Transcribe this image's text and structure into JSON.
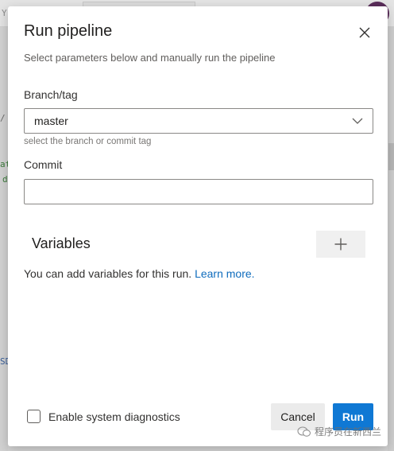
{
  "background": {
    "top_left_glyph": "Y",
    "left_glyphs": [
      "/",
      "at",
      "d",
      "SD"
    ]
  },
  "dialog": {
    "title": "Run pipeline",
    "subtitle": "Select parameters below and manually run the pipeline",
    "close_icon": "close-icon"
  },
  "branch": {
    "label": "Branch/tag",
    "value": "master",
    "helper": "select the branch or commit tag",
    "icon": "chevron-down-icon"
  },
  "commit": {
    "label": "Commit",
    "value": "",
    "placeholder": ""
  },
  "variables": {
    "title": "Variables",
    "add_icon": "plus-icon",
    "info_text": "You can add variables for this run.",
    "info_link": "Learn more."
  },
  "footer": {
    "diagnostics_label": "Enable system diagnostics",
    "diagnostics_checked": false,
    "cancel_label": "Cancel",
    "run_label": "Run"
  },
  "watermark": {
    "text": "程序员在新西兰",
    "icon": "wechat-icon"
  },
  "colors": {
    "accent": "#0f78d4",
    "link": "#0f6cbd",
    "avatar": "#5a2d5a"
  }
}
